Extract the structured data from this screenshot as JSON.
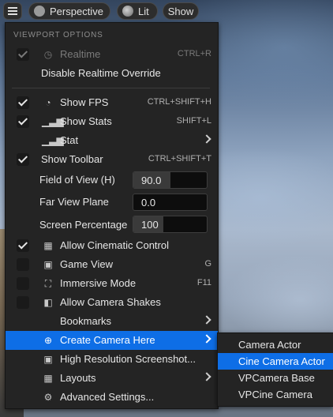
{
  "toolbar": {
    "perspective_label": "Perspective",
    "lit_label": "Lit",
    "show_label": "Show"
  },
  "menu": {
    "section_title": "VIEWPORT OPTIONS",
    "realtime": {
      "label": "Realtime",
      "shortcut": "CTRL+R"
    },
    "disable_realtime_override": {
      "label": "Disable Realtime Override"
    },
    "show_fps": {
      "label": "Show FPS",
      "shortcut": "CTRL+SHIFT+H"
    },
    "show_stats": {
      "label": "Show Stats",
      "shortcut": "SHIFT+L"
    },
    "stat": {
      "label": "Stat"
    },
    "show_toolbar": {
      "label": "Show Toolbar",
      "shortcut": "CTRL+SHIFT+T"
    },
    "field_of_view": {
      "label": "Field of View (H)",
      "value": "90.0",
      "fill_fraction": 0.5
    },
    "far_view_plane": {
      "label": "Far View Plane",
      "value": "0.0"
    },
    "screen_percentage": {
      "label": "Screen Percentage",
      "value": "100",
      "fill_fraction": 0.33
    },
    "allow_cinematic_control": {
      "label": "Allow Cinematic Control"
    },
    "game_view": {
      "label": "Game View",
      "shortcut": "G"
    },
    "immersive_mode": {
      "label": "Immersive Mode",
      "shortcut": "F11"
    },
    "allow_camera_shakes": {
      "label": "Allow Camera Shakes"
    },
    "bookmarks": {
      "label": "Bookmarks"
    },
    "create_camera_here": {
      "label": "Create Camera Here"
    },
    "high_res_screenshot": {
      "label": "High Resolution Screenshot..."
    },
    "layouts": {
      "label": "Layouts"
    },
    "advanced_settings": {
      "label": "Advanced Settings..."
    }
  },
  "submenu": {
    "items": [
      {
        "label": "Camera Actor"
      },
      {
        "label": "Cine Camera Actor"
      },
      {
        "label": "VPCamera Base"
      },
      {
        "label": "VPCine Camera"
      }
    ]
  },
  "colors": {
    "highlight": "#0e6ee6",
    "menu_bg": "#242424"
  }
}
